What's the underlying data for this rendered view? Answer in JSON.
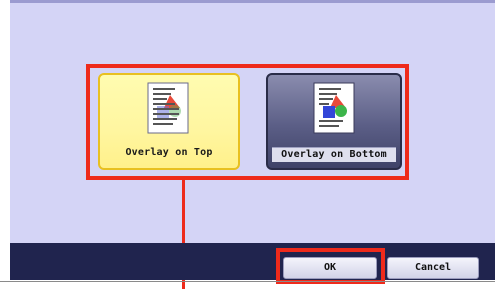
{
  "overlay_options": {
    "top_label": "Overlay on Top",
    "top_icon": "overlay-on-top-icon",
    "top_selected": true,
    "bottom_label": "Overlay on Bottom",
    "bottom_icon": "overlay-on-bottom-icon",
    "bottom_selected": false
  },
  "footer": {
    "ok_label": "OK",
    "cancel_label": "Cancel"
  },
  "colors": {
    "screen_background": "#d4d4f6",
    "footer_background": "#20244e",
    "highlight": "#ee2a1b",
    "selected_button": "#fff6a0",
    "unselected_button": "#5b5e86"
  }
}
